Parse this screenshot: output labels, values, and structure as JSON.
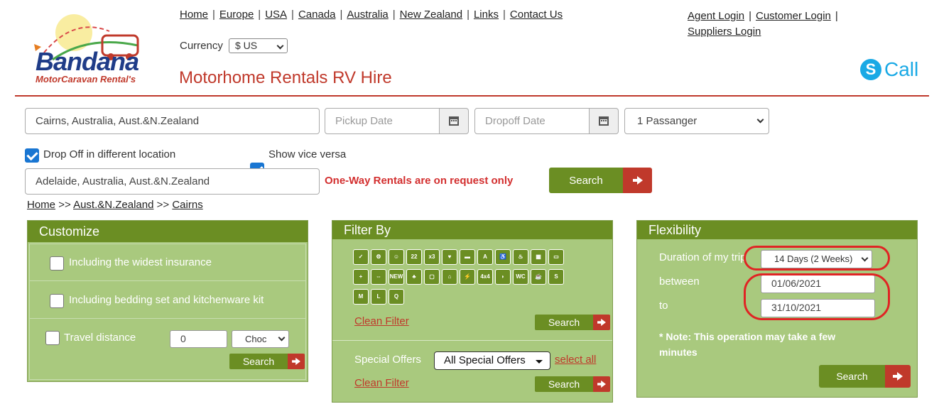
{
  "header": {
    "logo_text": "Bandana",
    "logo_subtext": "MotorCaravan Rental's",
    "nav": [
      "Home",
      "Europe",
      "USA",
      "Canada",
      "Australia",
      "New Zealand",
      "Links",
      "Contact Us"
    ],
    "login": {
      "agent": "Agent Login",
      "customer": "Customer Login",
      "suppliers": "Suppliers Login"
    },
    "currency_label": "Currency",
    "currency_value": "$ US",
    "site_title": "Motorhome Rentals RV Hire",
    "call_label": "Call"
  },
  "search": {
    "pickup_location": "Cairns, Australia, Aust.&N.Zealand",
    "pickup_date_placeholder": "Pickup Date",
    "dropoff_date_placeholder": "Dropoff Date",
    "passengers": "1 Passanger",
    "dropoff_diff_label": "Drop Off in different location",
    "vice_versa_label": "Show vice versa",
    "dropoff_location": "Adelaide, Australia, Aust.&N.Zealand",
    "oneway_note": "One-Way Rentals are on request only",
    "search_label": "Search"
  },
  "breadcrumb": {
    "home": "Home",
    "region": "Aust.&N.Zealand",
    "city": "Cairns",
    "sep": ">>"
  },
  "customize": {
    "title": "Customize",
    "insurance_label": "Including the widest insurance",
    "bedding_label": "Including bedding set and kitchenware kit",
    "distance_label": "Travel distance",
    "distance_value": "0",
    "distance_unit": "Choc",
    "search_label": "Search"
  },
  "filter": {
    "title": "Filter By",
    "icons": [
      "gear-check-icon",
      "gear-icon",
      "person-icon",
      "2-2-icon",
      "x3-icon",
      "family-icon",
      "bed-icon",
      "road-icon",
      "wheelchair-icon",
      "shower-icon",
      "toilet-icon",
      "van-icon",
      "add-person-icon",
      "size-icon",
      "new-icon",
      "group-icon",
      "tv-icon",
      "awning-icon",
      "power-icon",
      "4x4-icon",
      "caravan-icon",
      "wc-icon",
      "drink-icon",
      "s-icon",
      "m-icon",
      "l-icon",
      "quality-icon"
    ],
    "clean_label": "Clean Filter",
    "search_label": "Search",
    "offers_label": "Special Offers",
    "offers_value": "All Special Offers",
    "select_all": "select all"
  },
  "flex": {
    "title": "Flexibility",
    "duration_label": "Duration of my trip",
    "duration_value": "14 Days (2 Weeks)",
    "between_label": "between",
    "from_date": "01/06/2021",
    "to_label": "to",
    "to_date": "31/10/2021",
    "note": "* Note: This operation may take a few minutes",
    "search_label": "Search"
  },
  "colors": {
    "brand_red": "#c0392b",
    "panel_green": "#a9c97e",
    "head_green": "#6b8e23",
    "annotation_red": "#e02424"
  }
}
